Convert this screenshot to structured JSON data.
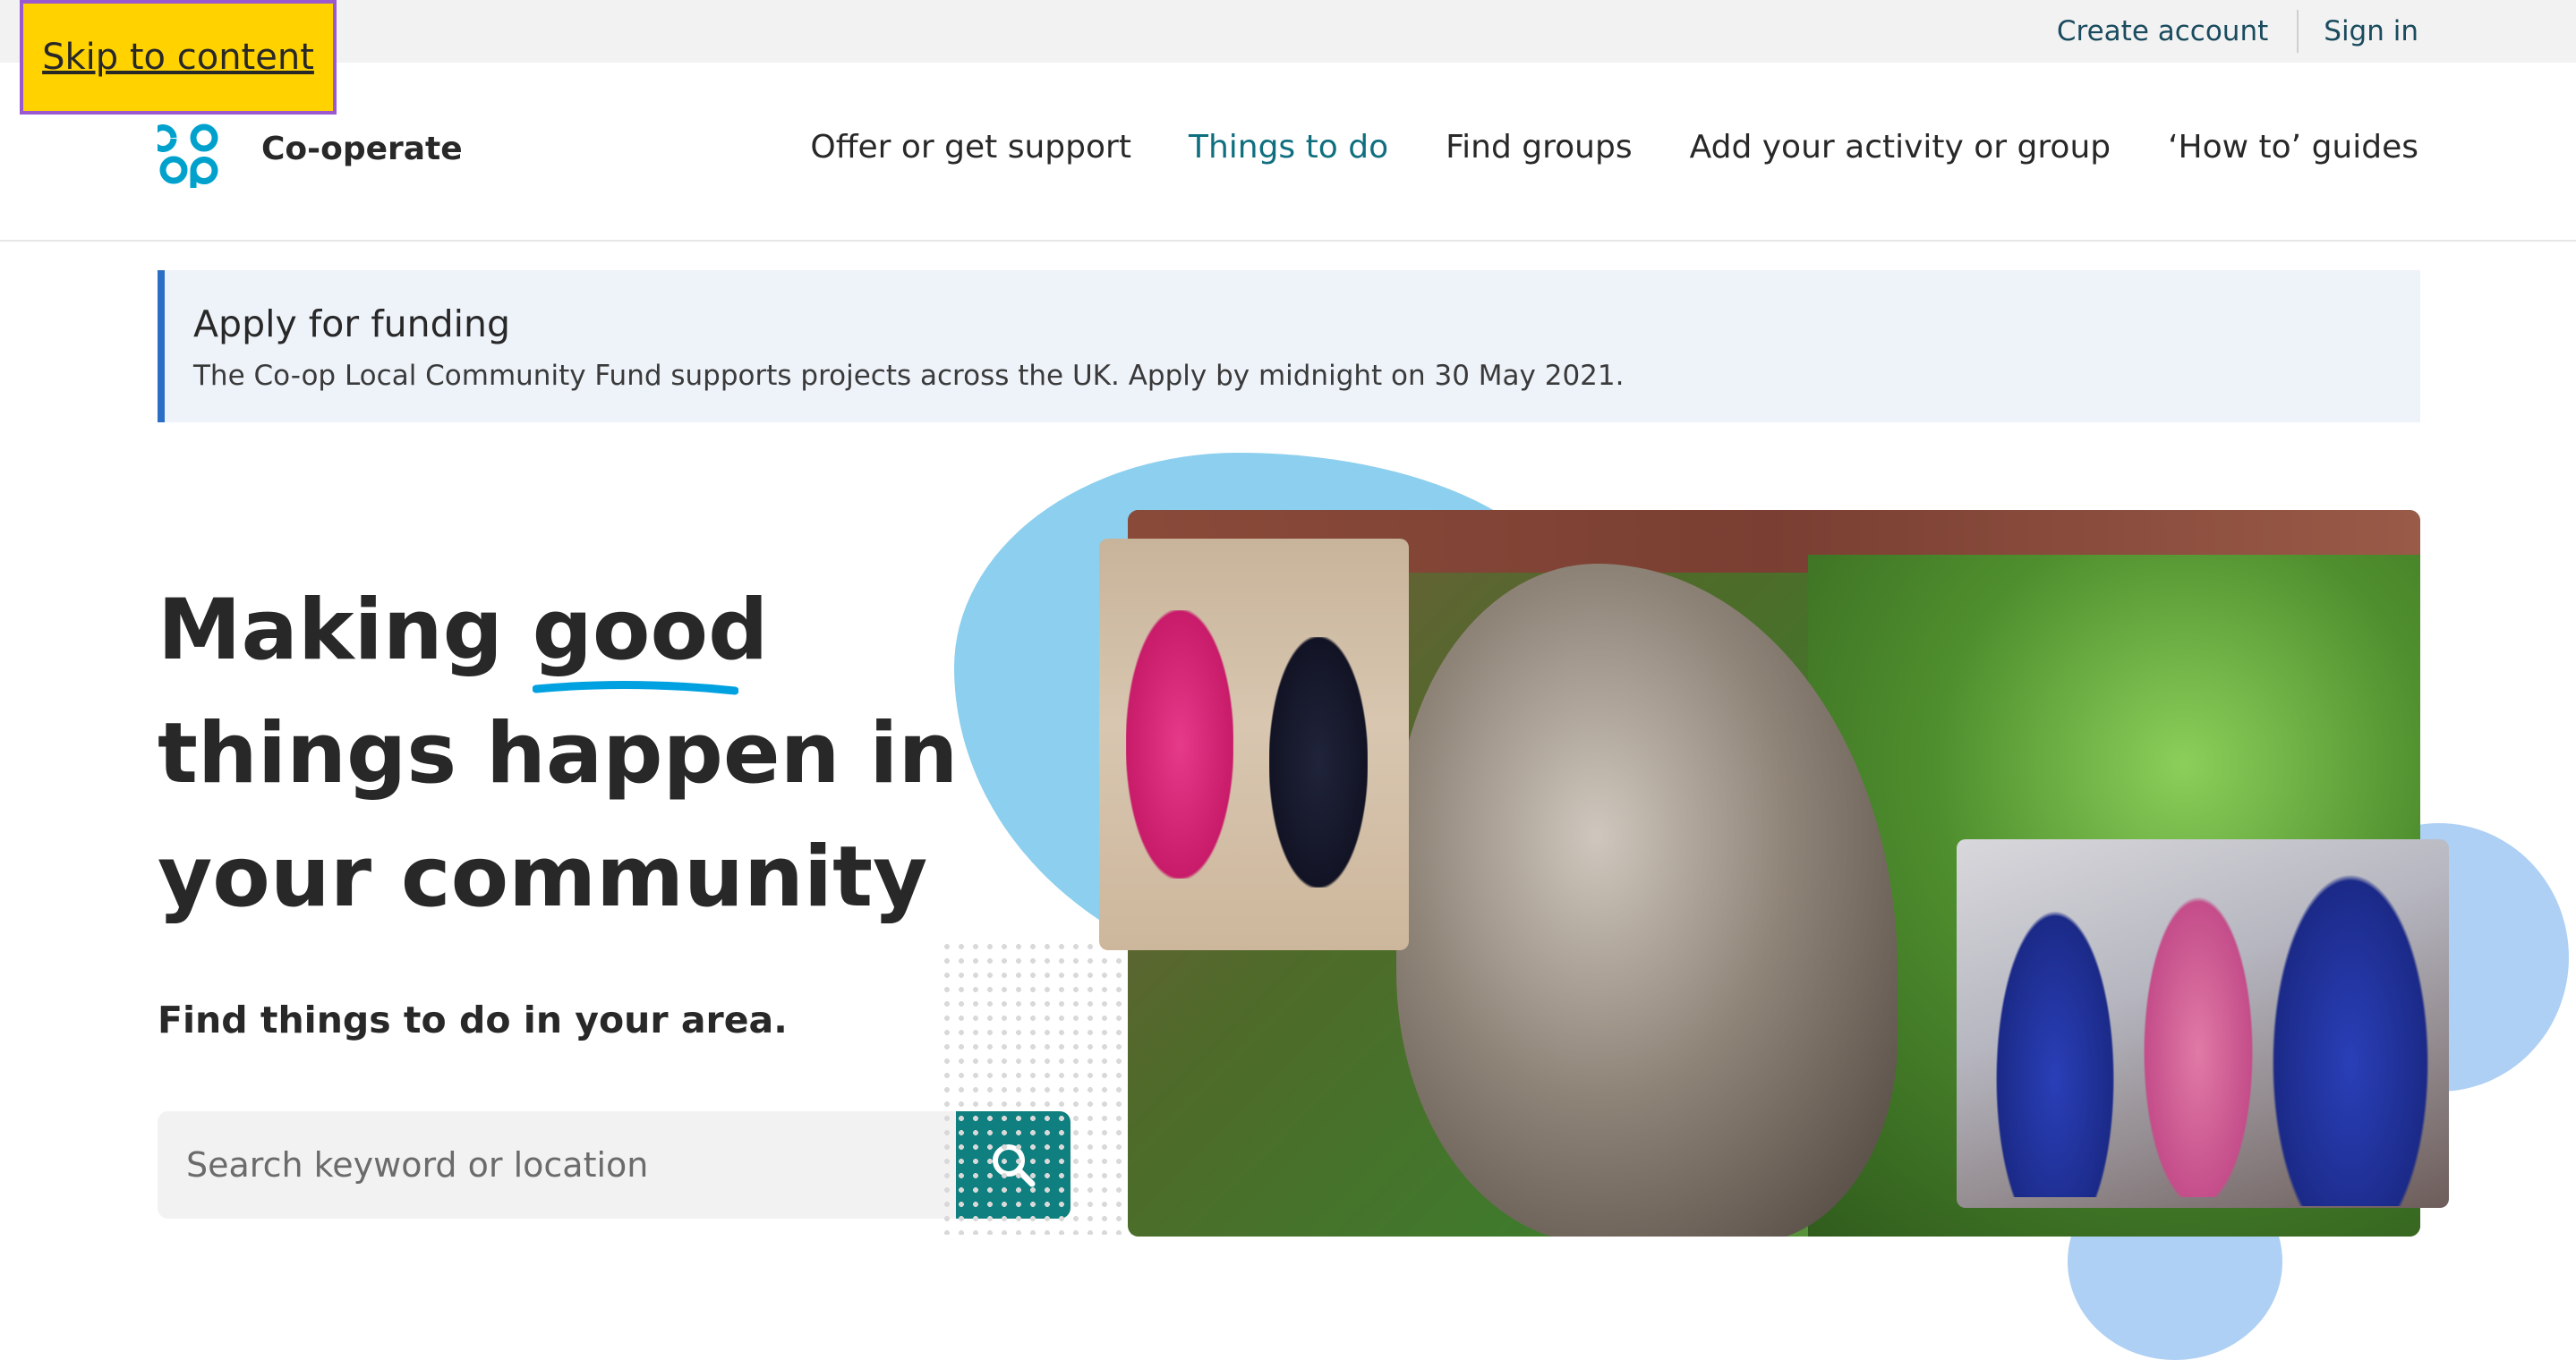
{
  "skip_link": "Skip to content",
  "account": {
    "create_account": "Create account",
    "sign_in": "Sign in"
  },
  "brand": {
    "name": "Co-operate",
    "logo_icon": "coop-logo-icon",
    "logo_color": "#00a1cc"
  },
  "nav": {
    "items": [
      {
        "label": "Offer or get support",
        "active": false
      },
      {
        "label": "Things to do",
        "active": true
      },
      {
        "label": "Find groups",
        "active": false
      },
      {
        "label": "Add your activity or group",
        "active": false
      },
      {
        "label": "‘How to’ guides",
        "active": false
      }
    ]
  },
  "banner": {
    "title": "Apply for funding",
    "text": "The Co-op Local Community Fund supports projects across the UK. Apply by midnight on 30 May 2021."
  },
  "hero": {
    "title_pre": "Making ",
    "title_emph": "good",
    "title_post": " things happen in your community",
    "subtitle": "Find things to do in your area.",
    "search_placeholder": "Search keyword or location",
    "search_icon": "search-icon"
  },
  "colors": {
    "accent": "#0f7f7f",
    "active_nav": "#0f6f7f",
    "highlight": "#ffd200",
    "underline": "#00a1e0",
    "banner_bg": "#eef3fa",
    "banner_border": "#2a6ec6"
  }
}
